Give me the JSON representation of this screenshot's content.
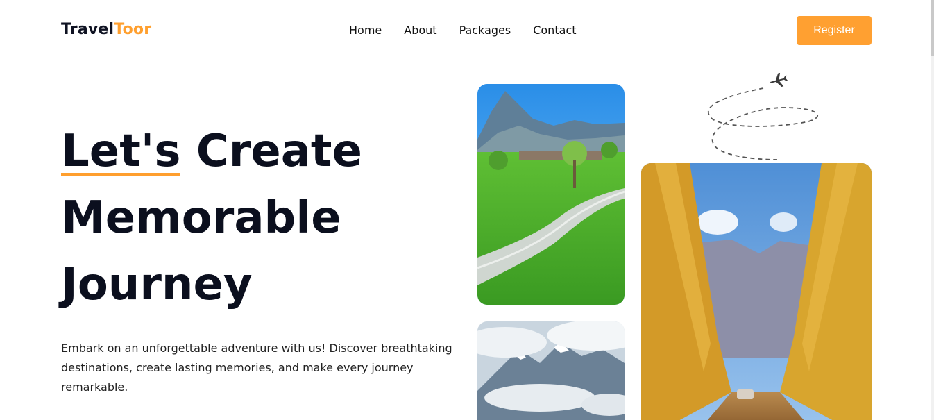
{
  "brand": {
    "part1": "Travel",
    "part2": "Toor",
    "accent": "#ff9f2e"
  },
  "nav": {
    "items": [
      "Home",
      "About",
      "Packages",
      "Contact"
    ]
  },
  "header": {
    "register_label": "Register"
  },
  "hero": {
    "title_highlight": "Let's",
    "title_rest_line1": "Create",
    "title_line2": "Memorable",
    "title_line3": "Journey",
    "description": "Embark on an unforgettable adventure with us! Discover breathtaking destinations, create lasting memories, and make every journey remarkable."
  },
  "icons": {
    "plane": "airplane-icon"
  }
}
